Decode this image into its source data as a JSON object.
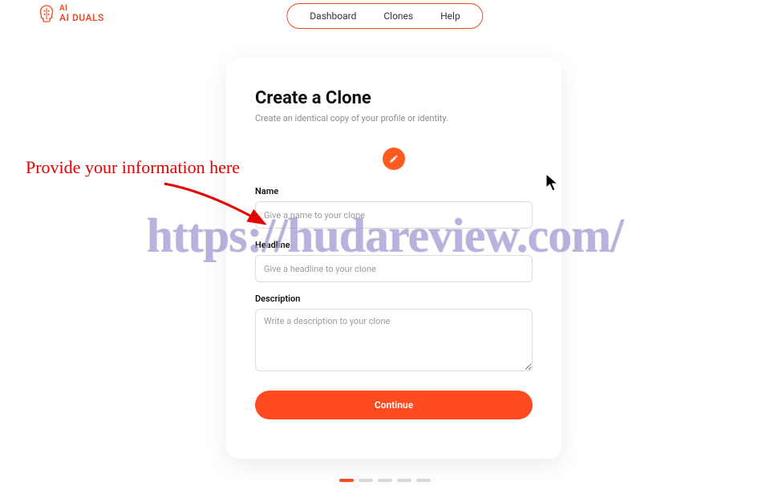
{
  "brand": {
    "name": "AI DUALS"
  },
  "nav": {
    "items": [
      "Dashboard",
      "Clones",
      "Help"
    ]
  },
  "card": {
    "title": "Create a Clone",
    "subtitle": "Create an identical copy of your profile or identity.",
    "fields": {
      "name_label": "Name",
      "name_placeholder": "Give a name to your clone",
      "headline_label": "Headline",
      "headline_placeholder": "Give a headline to your clone",
      "description_label": "Description",
      "description_placeholder": "Write a description to your clone"
    },
    "continue_label": "Continue",
    "steps_total": 5,
    "steps_active": 0
  },
  "annotation": {
    "text": "Provide your information here"
  },
  "watermark": "https://hudareview.com/",
  "colors": {
    "accent": "#ff4b1f",
    "annotation": "#e60000",
    "step_inactive": "#d9d9d9"
  }
}
